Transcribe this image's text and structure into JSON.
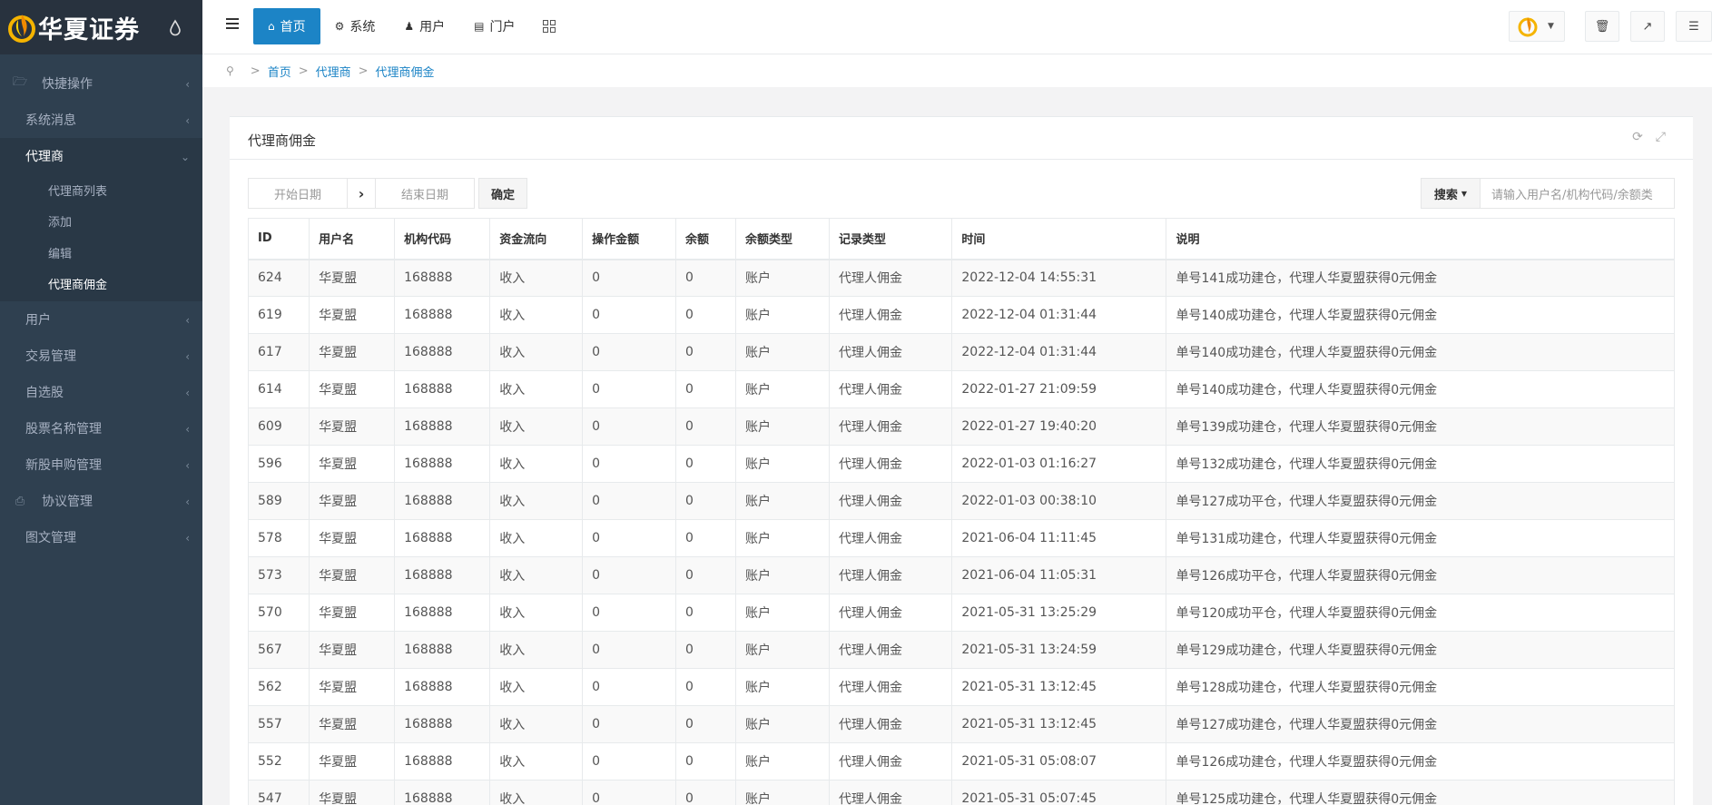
{
  "brand": {
    "title": "华夏证券",
    "accent": "#1c84c6",
    "sidebar_bg": "#2f4050"
  },
  "sidebar": {
    "items": [
      {
        "label": "快捷操作",
        "icon": "folder-icon",
        "lead_icon": true
      },
      {
        "label": "系统消息"
      },
      {
        "label": "代理商",
        "expanded": true
      },
      {
        "label": "用户"
      },
      {
        "label": "交易管理"
      },
      {
        "label": "自选股"
      },
      {
        "label": "股票名称管理"
      },
      {
        "label": "新股申购管理"
      },
      {
        "label": "协议管理",
        "icon": "printer-icon",
        "lead_icon": true
      },
      {
        "label": "图文管理"
      }
    ],
    "subitems": [
      {
        "label": "代理商列表"
      },
      {
        "label": "添加"
      },
      {
        "label": "编辑"
      },
      {
        "label": "代理商佣金",
        "current": true
      }
    ]
  },
  "topbar": {
    "nav": [
      {
        "label": "首页",
        "icon": "home-icon",
        "primary": true
      },
      {
        "label": "系统",
        "icon": "gear-icon"
      },
      {
        "label": "用户",
        "icon": "user-icon"
      },
      {
        "label": "门户",
        "icon": "portal-icon"
      }
    ]
  },
  "breadcrumb": [
    "首页",
    "代理商",
    "代理商佣金"
  ],
  "panel": {
    "title": "代理商佣金",
    "start_placeholder": "开始日期",
    "end_placeholder": "结束日期",
    "confirm_label": "确定",
    "search_label": "搜索",
    "search_placeholder": "请输入用户名/机构代码/余额类"
  },
  "table": {
    "columns": [
      "ID",
      "用户名",
      "机构代码",
      "资金流向",
      "操作金额",
      "余额",
      "余额类型",
      "记录类型",
      "时间",
      "说明"
    ],
    "rows": [
      [
        "624",
        "华夏盟",
        "168888",
        "收入",
        "0",
        "0",
        "账户",
        "代理人佣金",
        "2022-12-04 14:55:31",
        "单号141成功建仓，代理人华夏盟获得0元佣金"
      ],
      [
        "619",
        "华夏盟",
        "168888",
        "收入",
        "0",
        "0",
        "账户",
        "代理人佣金",
        "2022-12-04 01:31:44",
        "单号140成功建仓，代理人华夏盟获得0元佣金"
      ],
      [
        "617",
        "华夏盟",
        "168888",
        "收入",
        "0",
        "0",
        "账户",
        "代理人佣金",
        "2022-12-04 01:31:44",
        "单号140成功建仓，代理人华夏盟获得0元佣金"
      ],
      [
        "614",
        "华夏盟",
        "168888",
        "收入",
        "0",
        "0",
        "账户",
        "代理人佣金",
        "2022-01-27 21:09:59",
        "单号140成功建仓，代理人华夏盟获得0元佣金"
      ],
      [
        "609",
        "华夏盟",
        "168888",
        "收入",
        "0",
        "0",
        "账户",
        "代理人佣金",
        "2022-01-27 19:40:20",
        "单号139成功建仓，代理人华夏盟获得0元佣金"
      ],
      [
        "596",
        "华夏盟",
        "168888",
        "收入",
        "0",
        "0",
        "账户",
        "代理人佣金",
        "2022-01-03 01:16:27",
        "单号132成功建仓，代理人华夏盟获得0元佣金"
      ],
      [
        "589",
        "华夏盟",
        "168888",
        "收入",
        "0",
        "0",
        "账户",
        "代理人佣金",
        "2022-01-03 00:38:10",
        "单号127成功平仓，代理人华夏盟获得0元佣金"
      ],
      [
        "578",
        "华夏盟",
        "168888",
        "收入",
        "0",
        "0",
        "账户",
        "代理人佣金",
        "2021-06-04 11:11:45",
        "单号131成功建仓，代理人华夏盟获得0元佣金"
      ],
      [
        "573",
        "华夏盟",
        "168888",
        "收入",
        "0",
        "0",
        "账户",
        "代理人佣金",
        "2021-06-04 11:05:31",
        "单号126成功平仓，代理人华夏盟获得0元佣金"
      ],
      [
        "570",
        "华夏盟",
        "168888",
        "收入",
        "0",
        "0",
        "账户",
        "代理人佣金",
        "2021-05-31 13:25:29",
        "单号120成功平仓，代理人华夏盟获得0元佣金"
      ],
      [
        "567",
        "华夏盟",
        "168888",
        "收入",
        "0",
        "0",
        "账户",
        "代理人佣金",
        "2021-05-31 13:24:59",
        "单号129成功建仓，代理人华夏盟获得0元佣金"
      ],
      [
        "562",
        "华夏盟",
        "168888",
        "收入",
        "0",
        "0",
        "账户",
        "代理人佣金",
        "2021-05-31 13:12:45",
        "单号128成功建仓，代理人华夏盟获得0元佣金"
      ],
      [
        "557",
        "华夏盟",
        "168888",
        "收入",
        "0",
        "0",
        "账户",
        "代理人佣金",
        "2021-05-31 13:12:45",
        "单号127成功建仓，代理人华夏盟获得0元佣金"
      ],
      [
        "552",
        "华夏盟",
        "168888",
        "收入",
        "0",
        "0",
        "账户",
        "代理人佣金",
        "2021-05-31 05:08:07",
        "单号126成功建仓，代理人华夏盟获得0元佣金"
      ],
      [
        "547",
        "华夏盟",
        "168888",
        "收入",
        "0",
        "0",
        "账户",
        "代理人佣金",
        "2021-05-31 05:07:45",
        "单号125成功建仓，代理人华夏盟获得0元佣金"
      ]
    ]
  }
}
